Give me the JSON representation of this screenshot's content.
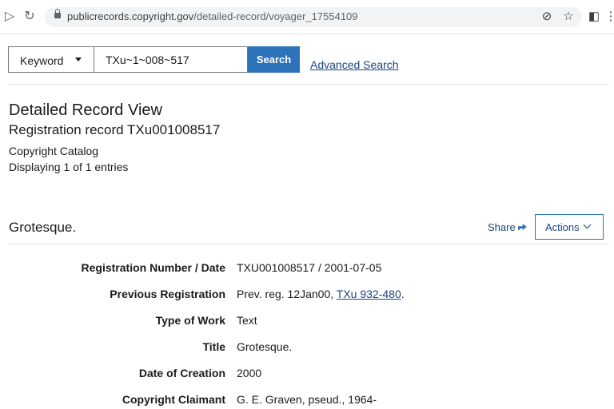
{
  "browser": {
    "url_domain": "publicrecords.copyright.gov",
    "url_path": "/detailed-record/voyager_17554109"
  },
  "search": {
    "type_selected": "Keyword",
    "query": "TXu~1~008~517",
    "button_label": "Search",
    "advanced_link": "Advanced Search"
  },
  "header": {
    "title": "Detailed Record View",
    "subtitle": "Registration record TXu001008517",
    "catalog": "Copyright Catalog",
    "count_text": "Displaying 1 of 1 entries"
  },
  "record": {
    "title": "Grotesque.",
    "share_label": "Share",
    "actions_label": "Actions",
    "fields": [
      {
        "label": "Registration Number / Date",
        "value": "TXU001008517 / 2001-07-05"
      },
      {
        "label": "Previous Registration",
        "value_prefix": "Prev. reg. 12Jan00, ",
        "value_link": "TXu 932-480",
        "value_suffix": "."
      },
      {
        "label": "Type of Work",
        "value": "Text"
      },
      {
        "label": "Title",
        "value": "Grotesque."
      },
      {
        "label": "Date of Creation",
        "value": "2000"
      },
      {
        "label": "Copyright Claimant",
        "value": "G. E. Graven, pseud., 1964-"
      }
    ]
  },
  "icons": {
    "forward": "forward-triangle-icon",
    "reload": "reload-icon",
    "lock": "lock-icon",
    "privacy": "eye-off-icon",
    "bookmark": "star-icon",
    "sidebar": "sidebar-panel-icon",
    "menu": "kebab-menu-icon"
  },
  "colors": {
    "accent": "#2e72b9",
    "link": "#1a4480"
  }
}
